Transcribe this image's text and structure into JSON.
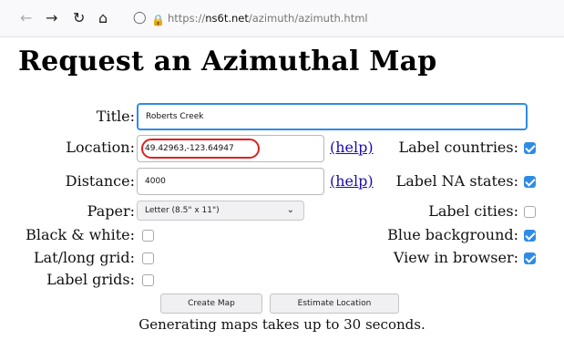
{
  "browser": {
    "url_prefix": "https://",
    "url_host": "ns6t.net",
    "url_path": "/azimuth/azimuth.html",
    "icons": [
      "back-icon",
      "forward-icon",
      "reload-icon",
      "home-icon",
      "shield-icon",
      "lock-icon"
    ]
  },
  "page": {
    "title": "Request an Azimuthal Map"
  },
  "form": {
    "title_label": "Title:",
    "title_value": "Roberts Creek",
    "location_label": "Location:",
    "location_value": "49.42963,-123.64947",
    "distance_label": "Distance:",
    "distance_value": "4000",
    "help_link": "(help)",
    "paper_label": "Paper:",
    "paper_value": "Letter (8.5\" x 11\")",
    "checkboxes": {
      "label_countries": {
        "label": "Label countries:",
        "checked": true
      },
      "label_na_states": {
        "label": "Label NA states:",
        "checked": true
      },
      "label_cities": {
        "label": "Label cities:",
        "checked": false
      },
      "blue_background": {
        "label": "Blue background:",
        "checked": true
      },
      "view_in_browser": {
        "label": "View in browser:",
        "checked": true
      },
      "black_white": {
        "label": "Black & white:",
        "checked": false
      },
      "latlong_grid": {
        "label": "Lat/long grid:",
        "checked": false
      },
      "label_grids": {
        "label": "Label grids:",
        "checked": false
      }
    },
    "create_button": "Create Map",
    "estimate_button": "Estimate Location",
    "note": "Generating maps takes up to 30 seconds."
  },
  "colors": {
    "accent": "#2f8ce5",
    "highlight_ring": "#e02020",
    "link": "#1a0dab"
  }
}
